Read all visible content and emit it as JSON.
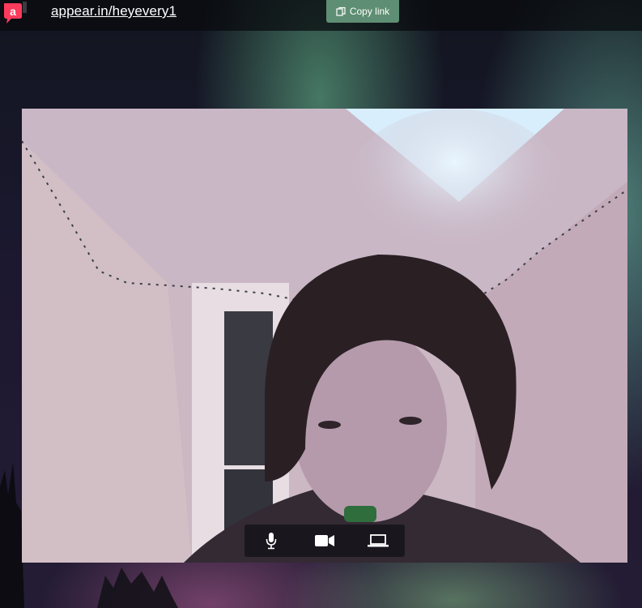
{
  "header": {
    "room_url": "appear.in/heyevery1",
    "copy_label": "Copy link"
  },
  "icons": {
    "logo": "appear-logo-icon",
    "copy": "copy-icon",
    "microphone": "microphone-icon",
    "camera": "camera-icon",
    "screenshare": "laptop-icon"
  },
  "colors": {
    "logo_red": "#ff3b5c",
    "copy_button": "#5e8e73",
    "topbar": "#0a0c10"
  }
}
